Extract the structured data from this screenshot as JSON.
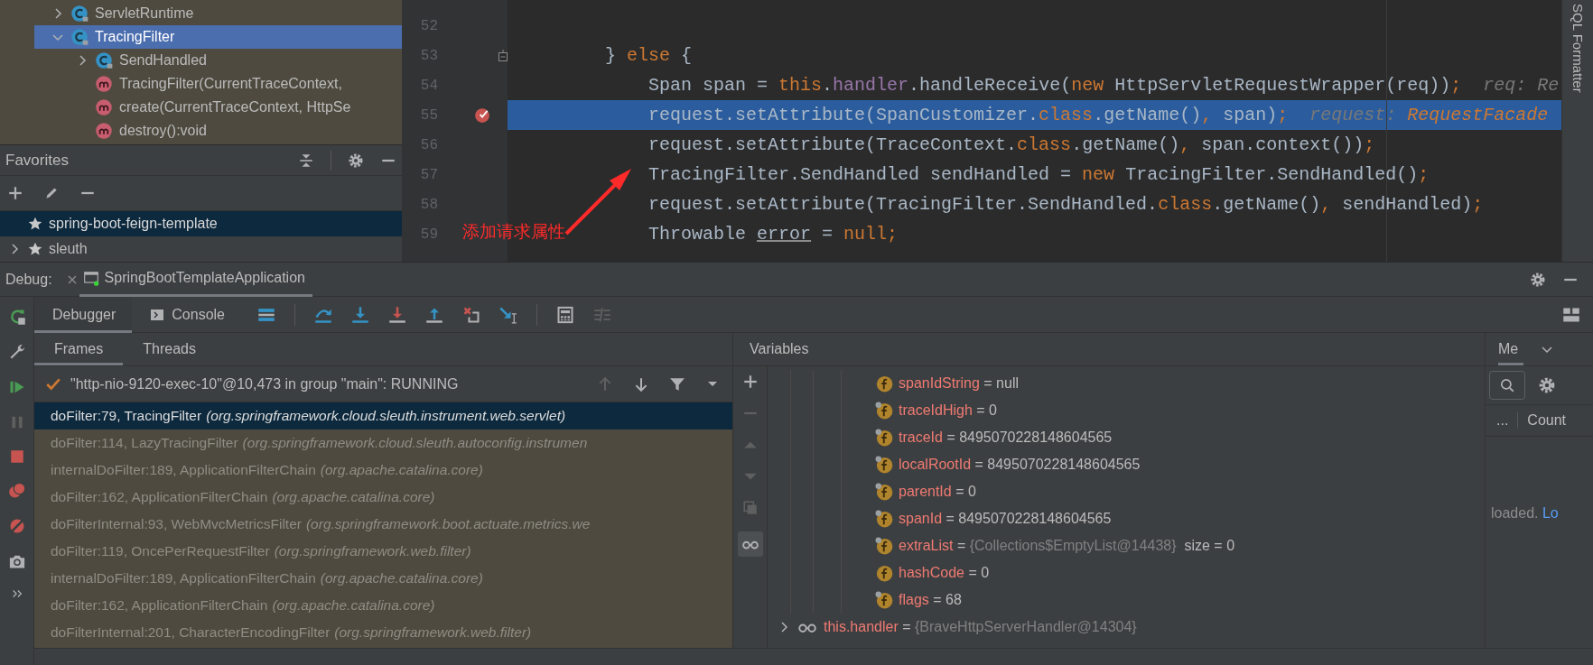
{
  "project_tree": [
    {
      "label": "ServletRuntime",
      "kind": "class",
      "expanded": false,
      "selected": false
    },
    {
      "label": "TracingFilter",
      "kind": "class",
      "expanded": true,
      "selected": true,
      "children": [
        {
          "label": "SendHandled",
          "kind": "class",
          "expanded": false,
          "selected": false
        },
        {
          "label": "TracingFilter(CurrentTraceContext,",
          "kind": "method",
          "selected": false
        },
        {
          "label": "create(CurrentTraceContext, HttpSe",
          "kind": "method",
          "selected": false
        },
        {
          "label": "destroy():void",
          "kind": "method",
          "selected": false
        }
      ]
    }
  ],
  "favorites": {
    "title": "Favorites",
    "items": [
      {
        "label": "spring-boot-feign-template",
        "selected": true
      },
      {
        "label": "sleuth",
        "selected": false,
        "expanded": false
      }
    ]
  },
  "editor": {
    "lines": [
      {
        "number": "52",
        "selected": false,
        "breakpoint": false,
        "fold": false
      },
      {
        "number": "53",
        "selected": false,
        "breakpoint": false,
        "fold": true,
        "tokens": [
          {
            "kind": "plain",
            "text": "        } "
          },
          {
            "kind": "keyword",
            "text": "else"
          },
          {
            "kind": "plain",
            "text": " {"
          }
        ]
      },
      {
        "number": "54",
        "selected": false,
        "breakpoint": false,
        "fold": false,
        "tokens": [
          {
            "kind": "plain",
            "text": "            Span span = "
          },
          {
            "kind": "keyword",
            "text": "this"
          },
          {
            "kind": "plain",
            "text": "."
          },
          {
            "kind": "field",
            "text": "handler"
          },
          {
            "kind": "plain",
            "text": ".handleReceive("
          },
          {
            "kind": "keyword",
            "text": "new"
          },
          {
            "kind": "plain",
            "text": " HttpServletRequestWrapper(req))"
          },
          {
            "kind": "keyword",
            "text": ";"
          },
          {
            "kind": "hint",
            "text": "req: Re"
          }
        ]
      },
      {
        "number": "55",
        "selected": true,
        "breakpoint": true,
        "fold": false,
        "tokens": [
          {
            "kind": "plain",
            "text": "            request.setAttribute(SpanCustomizer."
          },
          {
            "kind": "keyword",
            "text": "class"
          },
          {
            "kind": "plain",
            "text": ".getName()"
          },
          {
            "kind": "keyword",
            "text": ","
          },
          {
            "kind": "plain",
            "text": " span)"
          },
          {
            "kind": "keyword",
            "text": ";"
          },
          {
            "kind": "hint",
            "text": "request: "
          },
          {
            "kind": "hint_value",
            "text": "RequestFacade"
          }
        ]
      },
      {
        "number": "56",
        "selected": false,
        "breakpoint": false,
        "fold": false,
        "tokens": [
          {
            "kind": "plain",
            "text": "            request.setAttribute(TraceContext."
          },
          {
            "kind": "keyword",
            "text": "class"
          },
          {
            "kind": "plain",
            "text": ".getName()"
          },
          {
            "kind": "keyword",
            "text": ","
          },
          {
            "kind": "plain",
            "text": " span.context())"
          },
          {
            "kind": "keyword",
            "text": ";"
          }
        ]
      },
      {
        "number": "57",
        "selected": false,
        "breakpoint": false,
        "fold": false,
        "tokens": [
          {
            "kind": "plain",
            "text": "            TracingFilter.SendHandled sendHandled = "
          },
          {
            "kind": "keyword",
            "text": "new"
          },
          {
            "kind": "plain",
            "text": " TracingFilter.SendHandled()"
          },
          {
            "kind": "keyword",
            "text": ";"
          }
        ]
      },
      {
        "number": "58",
        "selected": false,
        "breakpoint": false,
        "fold": false,
        "tokens": [
          {
            "kind": "plain",
            "text": "            request.setAttribute(TracingFilter.SendHandled."
          },
          {
            "kind": "keyword",
            "text": "class"
          },
          {
            "kind": "plain",
            "text": ".getName()"
          },
          {
            "kind": "keyword",
            "text": ","
          },
          {
            "kind": "plain",
            "text": " sendHandled)"
          },
          {
            "kind": "keyword",
            "text": ";"
          }
        ]
      },
      {
        "number": "59",
        "selected": false,
        "breakpoint": false,
        "fold": false,
        "tokens": [
          {
            "kind": "plain",
            "text": "            Throwable "
          },
          {
            "kind": "warning",
            "text": "error"
          },
          {
            "kind": "plain",
            "text": " = "
          },
          {
            "kind": "keyword",
            "text": "null"
          },
          {
            "kind": "keyword",
            "text": ";"
          }
        ]
      }
    ],
    "annotation": {
      "text": "添加请求属性"
    }
  },
  "side_strip": {
    "label": "SQL Formatter"
  },
  "debug": {
    "label": "Debug:",
    "session": {
      "label": "SpringBootTemplateApplication",
      "selected": true
    },
    "tabs": [
      {
        "label": "Debugger",
        "selected": true
      },
      {
        "label": "Console",
        "selected": false
      }
    ],
    "frame_tabs": [
      {
        "label": "Frames",
        "selected": true
      },
      {
        "label": "Threads",
        "selected": false
      }
    ],
    "thread": "\"http-nio-9120-exec-10\"@10,473 in group \"main\": RUNNING",
    "frames": [
      {
        "method": "doFilter:79, TracingFilter",
        "package": "(org.springframework.cloud.sleuth.instrument.web.servlet)",
        "selected": true
      },
      {
        "method": "doFilter:114, LazyTracingFilter",
        "package": "(org.springframework.cloud.sleuth.autoconfig.instrumen",
        "selected": false
      },
      {
        "method": "internalDoFilter:189, ApplicationFilterChain",
        "package": "(org.apache.catalina.core)",
        "selected": false
      },
      {
        "method": "doFilter:162, ApplicationFilterChain",
        "package": "(org.apache.catalina.core)",
        "selected": false
      },
      {
        "method": "doFilterInternal:93, WebMvcMetricsFilter",
        "package": "(org.springframework.boot.actuate.metrics.we",
        "selected": false
      },
      {
        "method": "doFilter:119, OncePerRequestFilter",
        "package": "(org.springframework.web.filter)",
        "selected": false
      },
      {
        "method": "internalDoFilter:189, ApplicationFilterChain",
        "package": "(org.apache.catalina.core)",
        "selected": false
      },
      {
        "method": "doFilter:162, ApplicationFilterChain",
        "package": "(org.apache.catalina.core)",
        "selected": false
      },
      {
        "method": "doFilterInternal:201, CharacterEncodingFilter",
        "package": "(org.springframework.web.filter)",
        "selected": false
      }
    ],
    "variables": {
      "title": "Variables",
      "items": [
        {
          "name": "spanIdString",
          "op": "=",
          "value": "null",
          "kind": "value",
          "final": false
        },
        {
          "name": "traceIdHigh",
          "op": "=",
          "value": "0",
          "kind": "value",
          "final": true
        },
        {
          "name": "traceId",
          "op": "=",
          "value": "8495070228148604565",
          "kind": "value",
          "final": true
        },
        {
          "name": "localRootId",
          "op": "=",
          "value": "8495070228148604565",
          "kind": "value",
          "final": true
        },
        {
          "name": "parentId",
          "op": "=",
          "value": "0",
          "kind": "value",
          "final": true
        },
        {
          "name": "spanId",
          "op": "=",
          "value": "8495070228148604565",
          "kind": "value",
          "final": true
        },
        {
          "name": "extraList",
          "op": "=",
          "value": "{Collections$EmptyList@14438}",
          "extra": "size = 0",
          "kind": "ref",
          "final": true
        },
        {
          "name": "hashCode",
          "op": "=",
          "value": "0",
          "kind": "value",
          "final": false
        },
        {
          "name": "flags",
          "op": "=",
          "value": "68",
          "kind": "value",
          "final": true
        }
      ],
      "watch": {
        "name": "this.handler",
        "op": "=",
        "value": "{BraveHttpServerHandler@14304}",
        "expanded": false
      }
    },
    "memory": {
      "tab": "Me",
      "columns": [
        "...",
        "Count"
      ],
      "message": "loaded.",
      "link": "Lo"
    }
  }
}
